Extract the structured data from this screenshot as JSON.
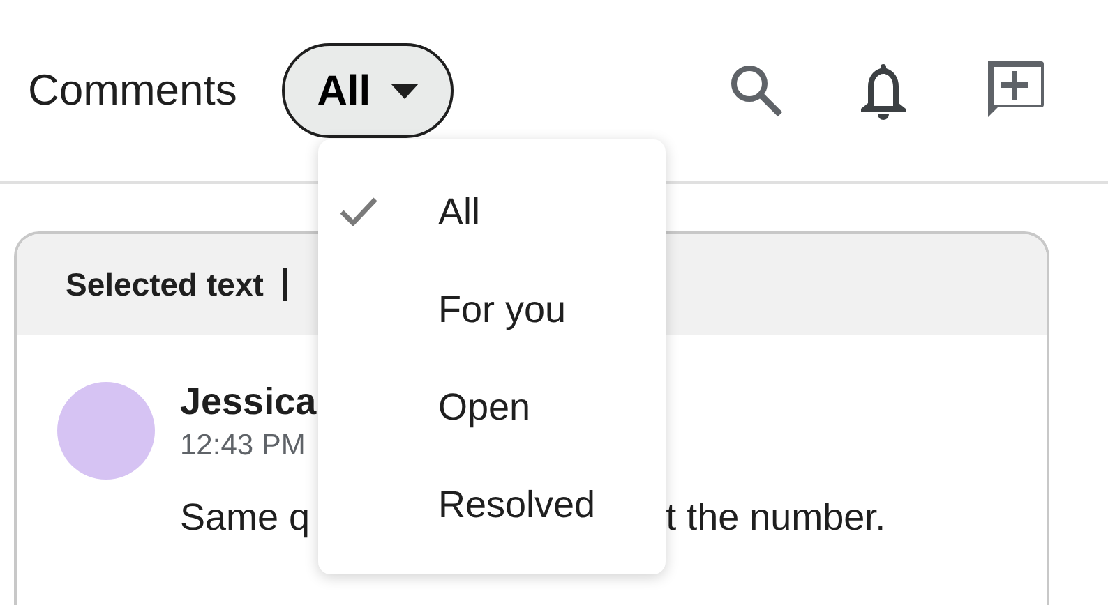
{
  "header": {
    "title": "Comments",
    "filter": {
      "label": "All",
      "expanded": true
    }
  },
  "filter_menu": [
    {
      "label": "All",
      "selected": true
    },
    {
      "label": "For you",
      "selected": false
    },
    {
      "label": "Open",
      "selected": false
    },
    {
      "label": "Resolved",
      "selected": false
    }
  ],
  "comment_card": {
    "quote_label": "Selected text",
    "author": "Jessica",
    "time": "12:43 PM",
    "text_start": "Same q",
    "text_end": "t the number."
  }
}
